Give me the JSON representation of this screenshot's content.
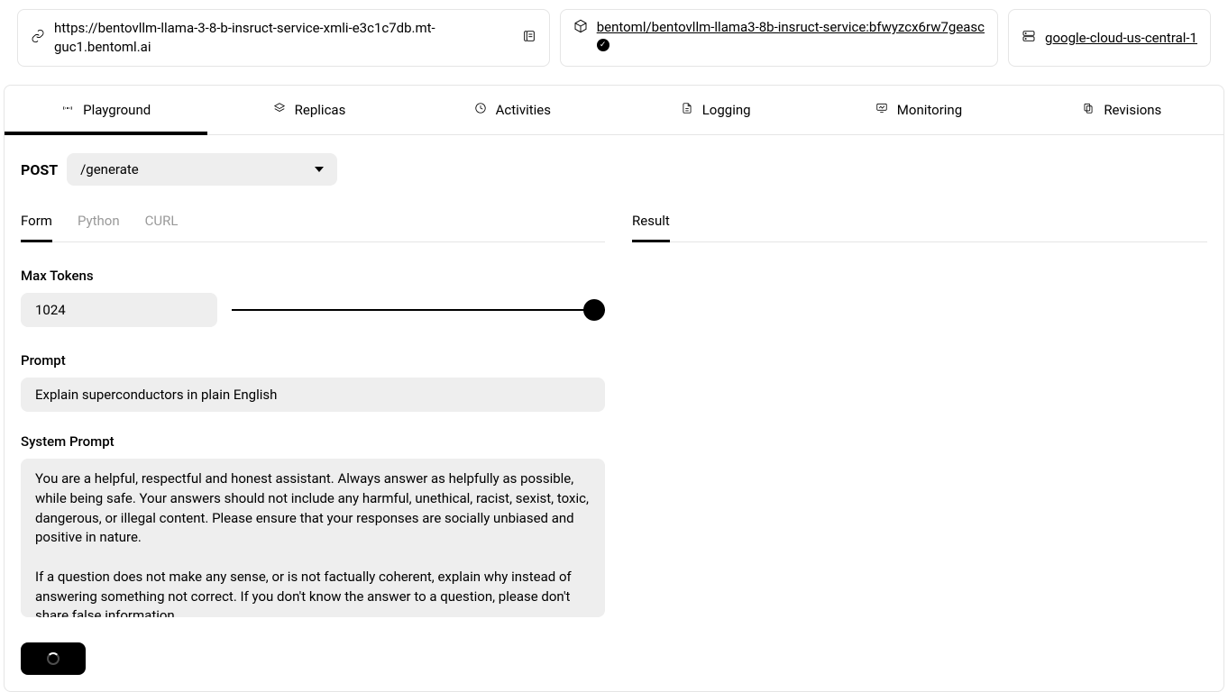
{
  "header": {
    "url": "https://bentovllm-llama-3-8-b-insruct-service-xmli-e3c1c7db.mt-guc1.bentoml.ai",
    "bento_ref": "bentoml/bentovllm-llama3-8b-insruct-service:bfwyzcx6rw7geasc",
    "region": "google-cloud-us-central-1"
  },
  "tabs": {
    "playground": "Playground",
    "replicas": "Replicas",
    "activities": "Activities",
    "logging": "Logging",
    "monitoring": "Monitoring",
    "revisions": "Revisions"
  },
  "playground": {
    "method": "POST",
    "endpoint": "/generate",
    "left_tabs": {
      "form": "Form",
      "python": "Python",
      "curl": "CURL"
    },
    "result_tab": "Result",
    "form": {
      "max_tokens_label": "Max Tokens",
      "max_tokens_value": "1024",
      "prompt_label": "Prompt",
      "prompt_value": "Explain superconductors in plain English",
      "system_prompt_label": "System Prompt",
      "system_prompt_value": "You are a helpful, respectful and honest assistant. Always answer as helpfully as possible, while being safe. Your answers should not include any harmful, unethical, racist, sexist, toxic, dangerous, or illegal content. Please ensure that your responses are socially unbiased and positive in nature.\n\nIf a question does not make any sense, or is not factually coherent, explain why instead of answering something not correct. If you don't know the answer to a question, please don't share false information."
    }
  }
}
